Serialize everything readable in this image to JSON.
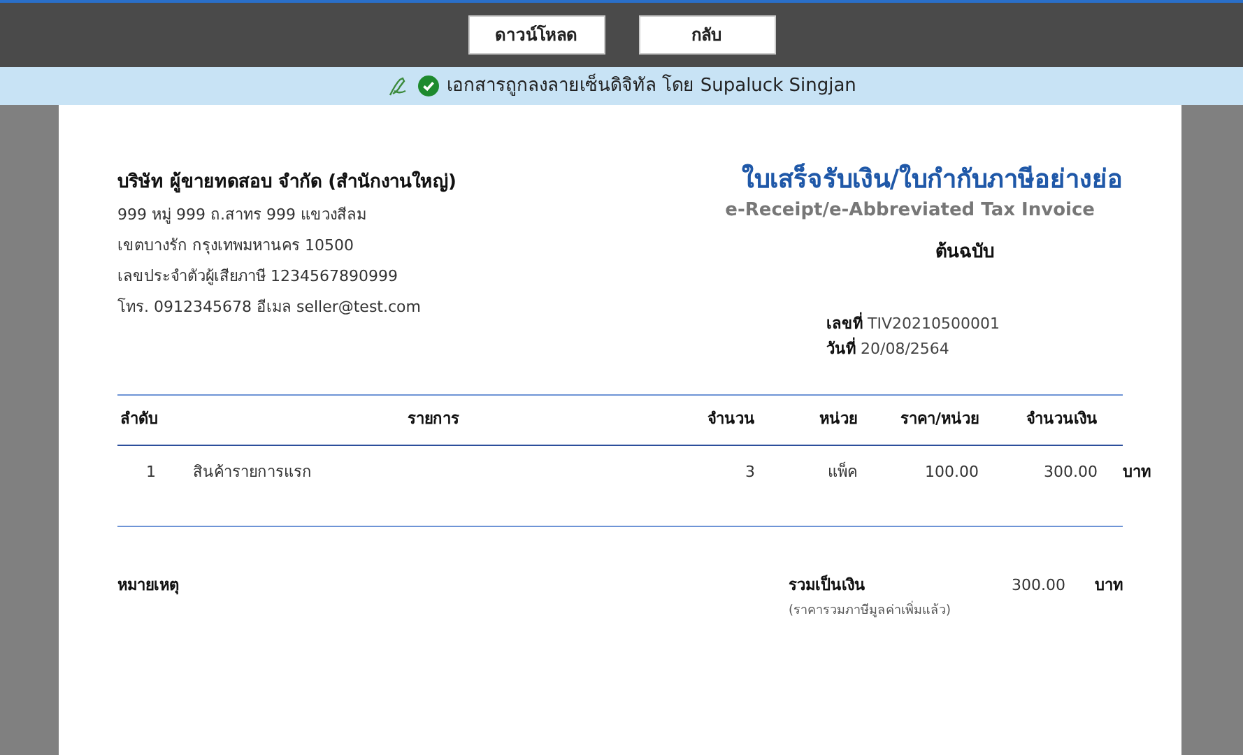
{
  "toolbar": {
    "buttons": [
      {
        "label": "ดาวน์โหลด"
      },
      {
        "label": "กลับ"
      }
    ]
  },
  "signature_banner": {
    "text": "เอกสารถูกลงลายเซ็นดิจิทัล โดย Supaluck Singjan",
    "verified": true
  },
  "seller": {
    "name": "บริษัท ผู้ขายทดสอบ จำกัด (สำนักงานใหญ่)",
    "lines": [
      "999 หมู่ 999 ถ.สาทร 999 แขวงสีลม",
      "เขตบางรัก  กรุงเทพมหานคร 10500",
      "เลขประจำตัวผู้เสียภาษี 1234567890999",
      "โทร. 0912345678  อีเมล seller@test.com"
    ]
  },
  "document": {
    "title": "ใบเสร็จรับเงิน/ใบกำกับภาษีอย่างย่อ",
    "subtitle": "e-Receipt/e-Abbreviated Tax Invoice",
    "copy_label": "ต้นฉบับ",
    "fields": [
      {
        "label": "เลขที่",
        "value": "TIV20210500001"
      },
      {
        "label": "วันที่",
        "value": "20/08/2564"
      }
    ]
  },
  "table": {
    "columns": [
      "ลำดับ",
      "รายการ",
      "จำนวน",
      "หน่วย",
      "ราคา/หน่วย",
      "จำนวนเงิน"
    ],
    "rows": [
      {
        "no": "1",
        "item": "สินค้ารายการแรก",
        "qty": "3",
        "unit": "แพ็ค",
        "price": "100.00",
        "amount": "300.00",
        "currency": "บาท"
      }
    ]
  },
  "notes_label": "หมายเหตุ",
  "total": {
    "label": "รวมเป็นเงิน",
    "note": "(ราคารวมภาษีมูลค่าเพิ่มแล้ว)",
    "amount": "300.00",
    "currency": "บาท"
  }
}
